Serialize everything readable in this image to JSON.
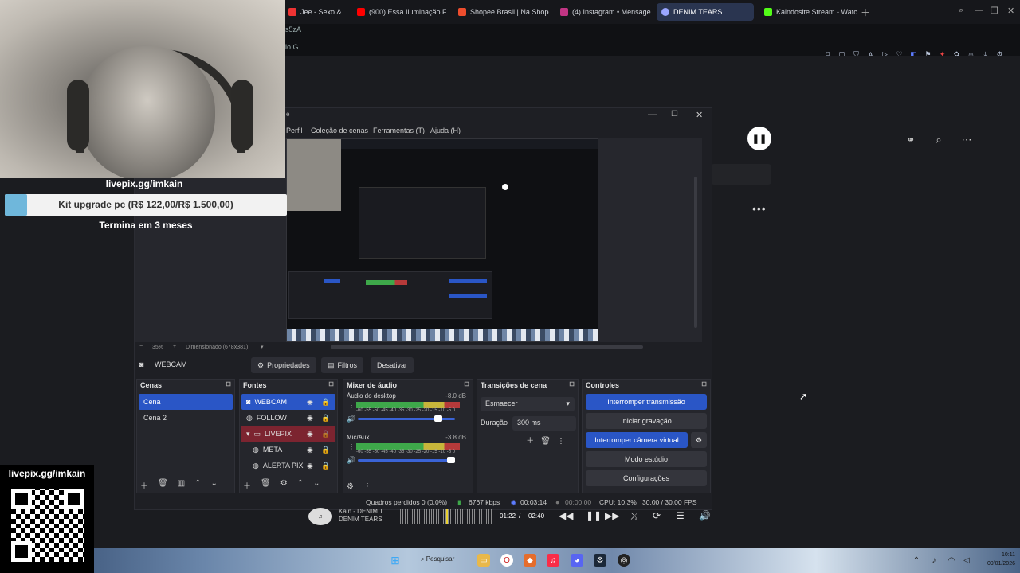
{
  "browser": {
    "tabs": [
      {
        "label": "Jee - Sexo & drama",
        "color": "#e33"
      },
      {
        "label": "(900) Essa Iluminação Fác",
        "color": "#f00"
      },
      {
        "label": "Shopee Brasil | Na Shopee",
        "color": "#ee4d2d"
      },
      {
        "label": "(4) Instagram • Mensagen",
        "color": "#c13584"
      },
      {
        "label": "DENIM TEARS",
        "color": "#9aa6ff"
      },
      {
        "label": "Kaindosite Stream - Watch",
        "color": "#53fc18"
      }
    ],
    "address_line1": "s5zA",
    "address_line2": "io G..."
  },
  "overlay": {
    "livepix_url": "livepix.gg/imkain",
    "goal_text": "Kit upgrade pc (R$ 122,00/R$ 1.500,00)",
    "goal_progress": 0.08,
    "goal_end": "Termina em 3 meses",
    "qr_label": "livepix.gg/imkain"
  },
  "obs": {
    "menu": [
      "Perfil",
      "Coleção de cenas",
      "Ferramentas (T)",
      "Ajuda (H)"
    ],
    "zoom": "35%",
    "scale_label": "Dimensionado (678x381)",
    "source_name": "WEBCAM",
    "buttons": {
      "properties": "Propriedades",
      "filters": "Filtros",
      "disable": "Desativar"
    },
    "scenes": {
      "title": "Cenas",
      "items": [
        "Cena",
        "Cena 2"
      ]
    },
    "sources": {
      "title": "Fontes",
      "items": [
        "WEBCAM",
        "FOLLOW",
        "LIVEPIX",
        "META",
        "ALERTA PIX"
      ]
    },
    "mixer": {
      "title": "Mixer de áudio",
      "channels": [
        {
          "name": "Áudio do desktop",
          "db": "-8.0 dB",
          "level": 0.85
        },
        {
          "name": "Mic/Aux",
          "db": "-3.8 dB",
          "level": 0.93
        }
      ],
      "scale": "-60 -55 -50 -45 -40 -35 -30 -25 -20 -15 -10 -5 0"
    },
    "transitions": {
      "title": "Transições de cena",
      "type": "Esmaecer",
      "duration_label": "Duração",
      "duration": "300 ms"
    },
    "controls": {
      "title": "Controles",
      "stop_stream": "Interromper transmissão",
      "start_record": "Iniciar gravação",
      "stop_vcam": "Interromper câmera virtual",
      "studio": "Modo estúdio",
      "settings": "Configurações"
    },
    "status": {
      "dropped": "Quadros perdidos 0 (0.0%)",
      "bitrate": "6767 kbps",
      "live_time": "00:03:14",
      "rec_time": "00:00:00",
      "cpu": "CPU: 10.3%",
      "fps": "30.00 / 30.00 FPS"
    }
  },
  "player": {
    "artist": "Kain - DENIM T",
    "title": "DENIM TEARS",
    "elapsed": "01:22",
    "total": "02:40",
    "progress": 0.51
  },
  "taskbar": {
    "search": "Pesquisar",
    "time": "10:11",
    "date": "09/01/2026"
  }
}
